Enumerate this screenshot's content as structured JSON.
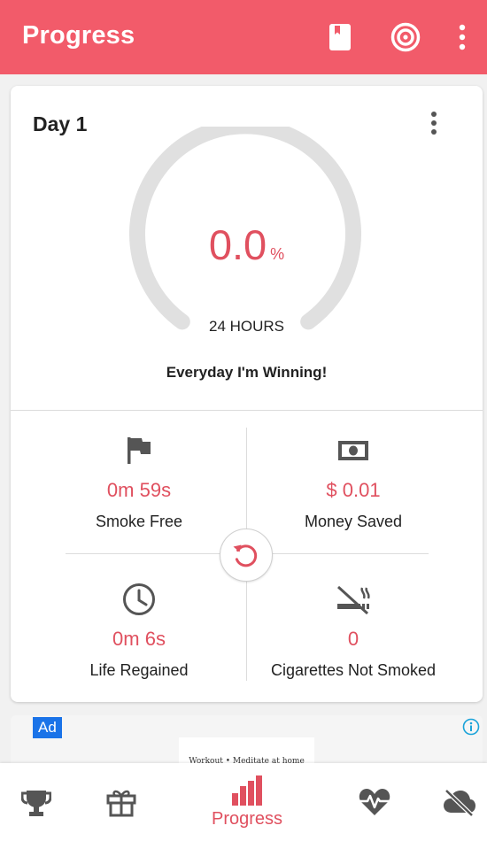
{
  "appbar": {
    "title": "Progress",
    "icons": [
      "book-icon",
      "target-icon",
      "more-vert-icon"
    ]
  },
  "card": {
    "day_label": "Day 1",
    "progress": {
      "value": "0.0",
      "unit": "%",
      "fraction": 0.0
    },
    "duration_label": "24 HOURS",
    "motto": "Everyday I'm Winning!",
    "stats": [
      {
        "icon": "flag-icon",
        "value": "0m 59s",
        "label": "Smoke Free"
      },
      {
        "icon": "money-icon",
        "value": "$ 0.01",
        "label": "Money Saved"
      },
      {
        "icon": "clock-icon",
        "value": "0m 6s",
        "label": "Life Regained"
      },
      {
        "icon": "no-smoking-icon",
        "value": "0",
        "label": "Cigarettes Not Smoked"
      }
    ]
  },
  "ad": {
    "badge": "Ad",
    "text": "Workout • Meditate at home"
  },
  "bottom_nav": {
    "items": [
      {
        "icon": "trophy-icon"
      },
      {
        "icon": "gift-icon"
      },
      {
        "icon": "bar-chart-icon",
        "label": "Progress",
        "active": true
      },
      {
        "icon": "heartbeat-icon"
      },
      {
        "icon": "cloud-off-icon"
      }
    ]
  },
  "colors": {
    "accent": "#f25b6a",
    "value_text": "#e0505f",
    "gauge_track": "#e0e0e0",
    "icon": "#555555"
  }
}
